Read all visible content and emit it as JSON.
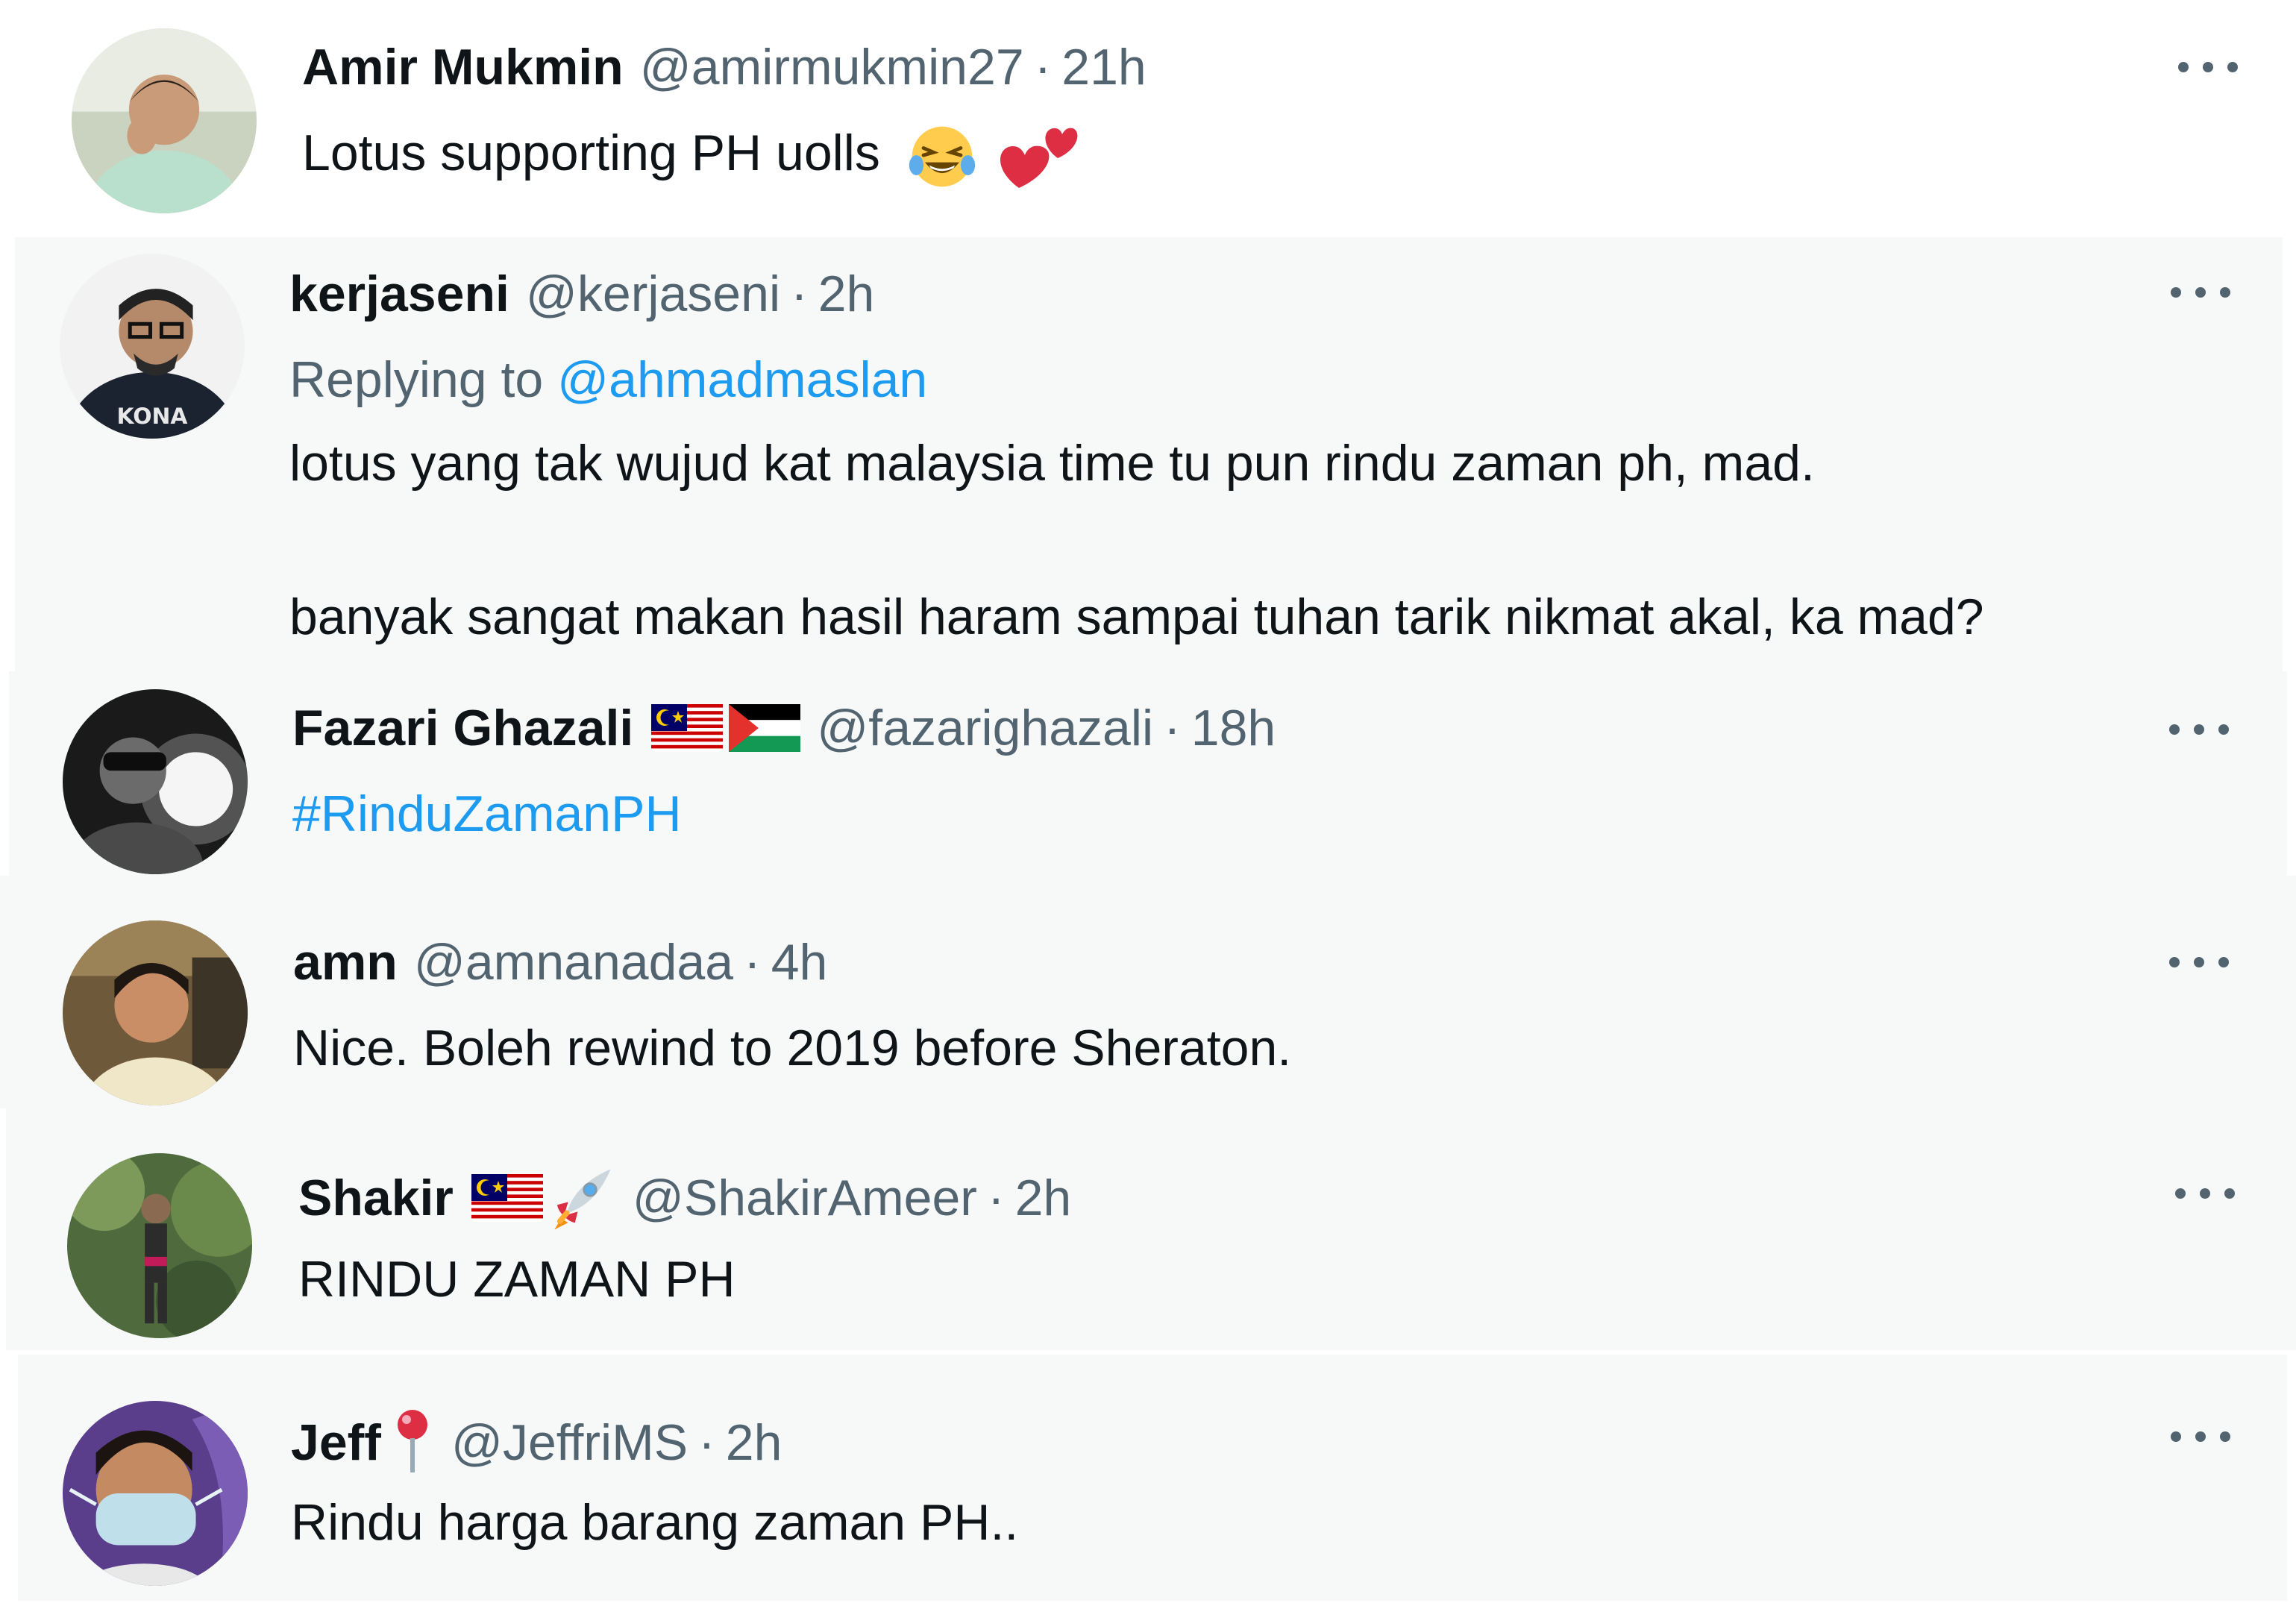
{
  "tweets": [
    {
      "name": "Amir Mukmin",
      "handle": "@amirmukmin27",
      "separator": "·",
      "time": "21h",
      "text": "Lotus supporting PH uolls",
      "emojis": [
        "laughing-tears-icon",
        "two-hearts-icon"
      ]
    },
    {
      "name": "kerjaseni",
      "handle": "@kerjaseni",
      "separator": "·",
      "time": "2h",
      "replying_prefix": "Replying to ",
      "replying_to": "@ahmadmaslan",
      "text_line1": "lotus yang tak wujud kat malaysia time tu pun rindu zaman ph, mad.",
      "text_line2": "banyak sangat makan hasil haram sampai tuhan tarik nikmat akal, ka mad?"
    },
    {
      "name": "Fazari Ghazali",
      "name_emojis": [
        "malaysia-flag-icon",
        "palestine-flag-icon"
      ],
      "handle": "@fazarighazali",
      "separator": "·",
      "time": "18h",
      "hashtag": "#RinduZamanPH"
    },
    {
      "name": "amn",
      "handle": "@amnanadaa",
      "separator": "·",
      "time": "4h",
      "text": "Nice. Boleh rewind to 2019 before Sheraton."
    },
    {
      "name": "Shakir",
      "name_emojis": [
        "malaysia-flag-icon",
        "rocket-icon"
      ],
      "handle": "@ShakirAmeer",
      "separator": "·",
      "time": "2h",
      "text": "RINDU ZAMAN PH"
    },
    {
      "name": "Jeff",
      "name_emojis": [
        "pin-icon"
      ],
      "handle": "@JeffriMS",
      "separator": "·",
      "time": "2h",
      "text": "Rindu harga barang zaman PH.."
    }
  ],
  "colors": {
    "text": "#0f1419",
    "secondary": "#536471",
    "link": "#1d9bf0",
    "card_bg": "#f7f9f9"
  }
}
